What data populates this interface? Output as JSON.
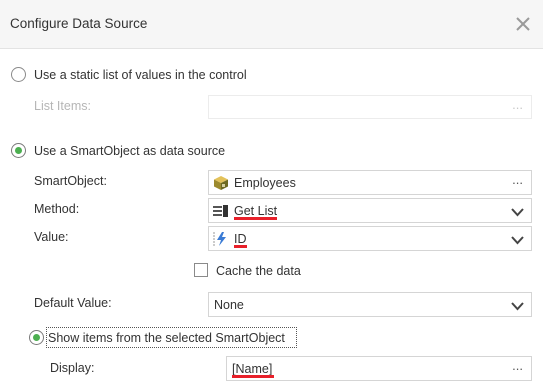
{
  "dialog": {
    "title": "Configure Data Source",
    "close_icon": "close-icon"
  },
  "static_option": {
    "label": "Use a static list of values in the control",
    "list_items_label": "List Items:",
    "list_items_value": "",
    "ellipsis": "..."
  },
  "smartobject_option": {
    "label": "Use a SmartObject as data source",
    "smartobject_label": "SmartObject:",
    "smartobject_value": "Employees",
    "smartobject_icon": "smartobject-cube-icon",
    "method_label": "Method:",
    "method_value": "Get List",
    "method_icon": "list-method-icon",
    "value_label": "Value:",
    "value_value": "ID",
    "value_icon": "property-lightning-icon",
    "cache_label": "Cache the data",
    "cache_checked": false,
    "default_label": "Default Value:",
    "default_value": "None",
    "show_items_label": "Show items from the selected SmartObject",
    "display_label": "Display:",
    "display_value": "[Name]",
    "ellipsis": "..."
  },
  "colors": {
    "accent_green": "#4caf50",
    "error_underline": "#e8202a",
    "header_bg": "#f6f6f6"
  }
}
